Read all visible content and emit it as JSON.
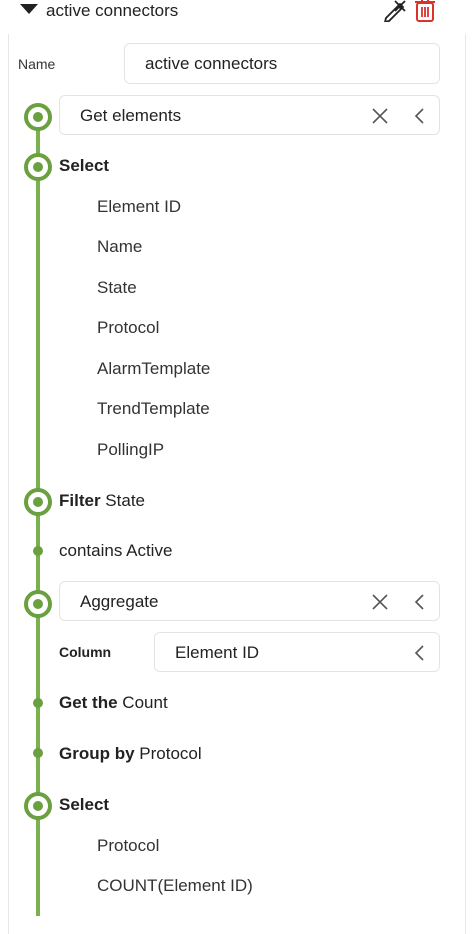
{
  "header": {
    "title": "active connectors"
  },
  "name_field": {
    "label": "Name",
    "value": "active connectors"
  },
  "steps": {
    "get_elements": {
      "value": "Get elements"
    },
    "select1": {
      "label": "Select",
      "columns": [
        "Element ID",
        "Name",
        "State",
        "Protocol",
        "AlarmTemplate",
        "TrendTemplate",
        "PollingIP"
      ]
    },
    "filter": {
      "keyword": "Filter",
      "column": "State"
    },
    "contains": {
      "text": "contains Active"
    },
    "aggregate": {
      "value": "Aggregate"
    },
    "column_field": {
      "label": "Column",
      "value": "Element ID"
    },
    "count": {
      "keyword": "Get the",
      "text": "Count"
    },
    "group": {
      "keyword": "Group by",
      "text": "Protocol"
    },
    "select2": {
      "label": "Select",
      "columns": [
        "Protocol",
        "COUNT(Element ID)"
      ]
    }
  },
  "icons": {
    "pen": "pen-with-x-icon",
    "trash": "trash-icon",
    "clear": "x-icon",
    "collapse": "chevron-left-icon"
  },
  "colors": {
    "accent": "#6aa03f",
    "trash": "#d9342b"
  }
}
